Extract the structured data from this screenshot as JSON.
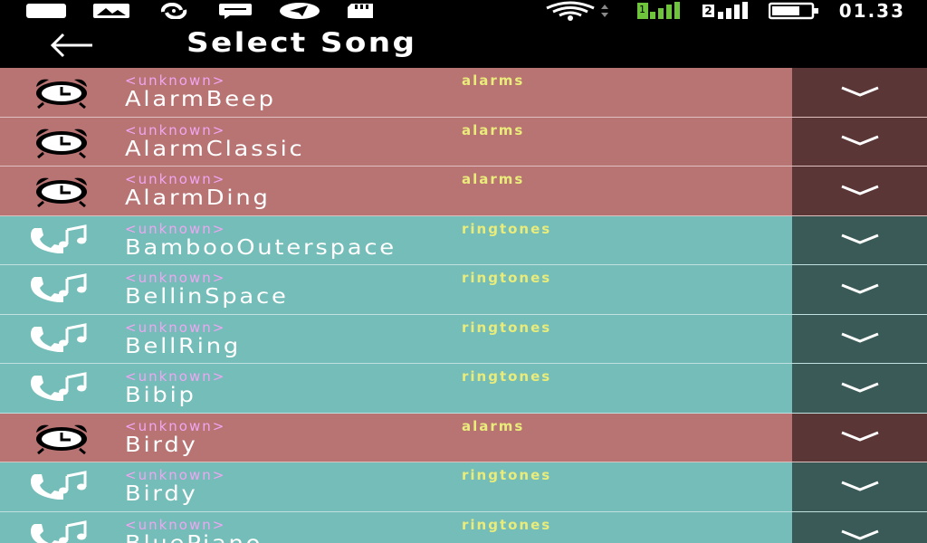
{
  "status_bar": {
    "time": "01.33",
    "sim2_label": "2",
    "icons": [
      "square-icon",
      "image-icon",
      "sync-icon",
      "chat-icon",
      "telegram-icon",
      "sd-card-icon",
      "wifi-icon",
      "data-arrows-icon",
      "signal-1-icon",
      "signal-2-icon",
      "battery-icon"
    ]
  },
  "app_bar": {
    "title": "Select Song",
    "back_icon": "arrow-left-icon"
  },
  "songs": [
    {
      "artist": "<unknown>",
      "title": "AlarmBeep",
      "category": "alarms",
      "icon": "alarm-clock-icon"
    },
    {
      "artist": "<unknown>",
      "title": "AlarmClassic",
      "category": "alarms",
      "icon": "alarm-clock-icon"
    },
    {
      "artist": "<unknown>",
      "title": "AlarmDing",
      "category": "alarms",
      "icon": "alarm-clock-icon"
    },
    {
      "artist": "<unknown>",
      "title": "BambooOuterspace",
      "category": "ringtones",
      "icon": "phone-music-icon"
    },
    {
      "artist": "<unknown>",
      "title": "BellinSpace",
      "category": "ringtones",
      "icon": "phone-music-icon"
    },
    {
      "artist": "<unknown>",
      "title": "BellRing",
      "category": "ringtones",
      "icon": "phone-music-icon"
    },
    {
      "artist": "<unknown>",
      "title": "Bibip",
      "category": "ringtones",
      "icon": "phone-music-icon"
    },
    {
      "artist": "<unknown>",
      "title": "Birdy",
      "category": "alarms",
      "icon": "alarm-clock-icon"
    },
    {
      "artist": "<unknown>",
      "title": "Birdy",
      "category": "ringtones",
      "icon": "phone-music-icon"
    },
    {
      "artist": "<unknown>",
      "title": "BluePiano",
      "category": "ringtones",
      "icon": "phone-music-icon"
    }
  ],
  "colors": {
    "alarm_row": "#b87373",
    "alarm_expand": "#5a3636",
    "ringtone_row": "#74bdb9",
    "ringtone_expand": "#3a5a58",
    "artist_text": "#f0a6f2",
    "category_text": "#e9ec7a"
  }
}
